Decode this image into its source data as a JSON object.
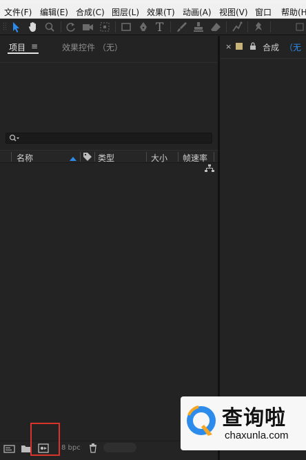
{
  "menu": {
    "items": [
      "文件(F)",
      "编辑(E)",
      "合成(C)",
      "图层(L)",
      "效果(T)",
      "动画(A)",
      "视图(V)",
      "窗口",
      "帮助(H"
    ]
  },
  "project_panel": {
    "tab_project": "项目",
    "tab_menu_glyph": "≡",
    "tab_effects": "效果控件 （无）",
    "columns": [
      "名称",
      "类型",
      "大小",
      "帧速率"
    ]
  },
  "composition_panel": {
    "close_glyph": "×",
    "tab_label": "合成",
    "tab_value": "（无"
  },
  "bottom_bar": {
    "bit_depth": "8 bpc"
  },
  "watermark": {
    "title": "查询啦",
    "url": "chaxunla.com"
  },
  "colors": {
    "accent": "#2d8ceb",
    "panel_bg": "#232323",
    "highlight": "#d9342b"
  }
}
